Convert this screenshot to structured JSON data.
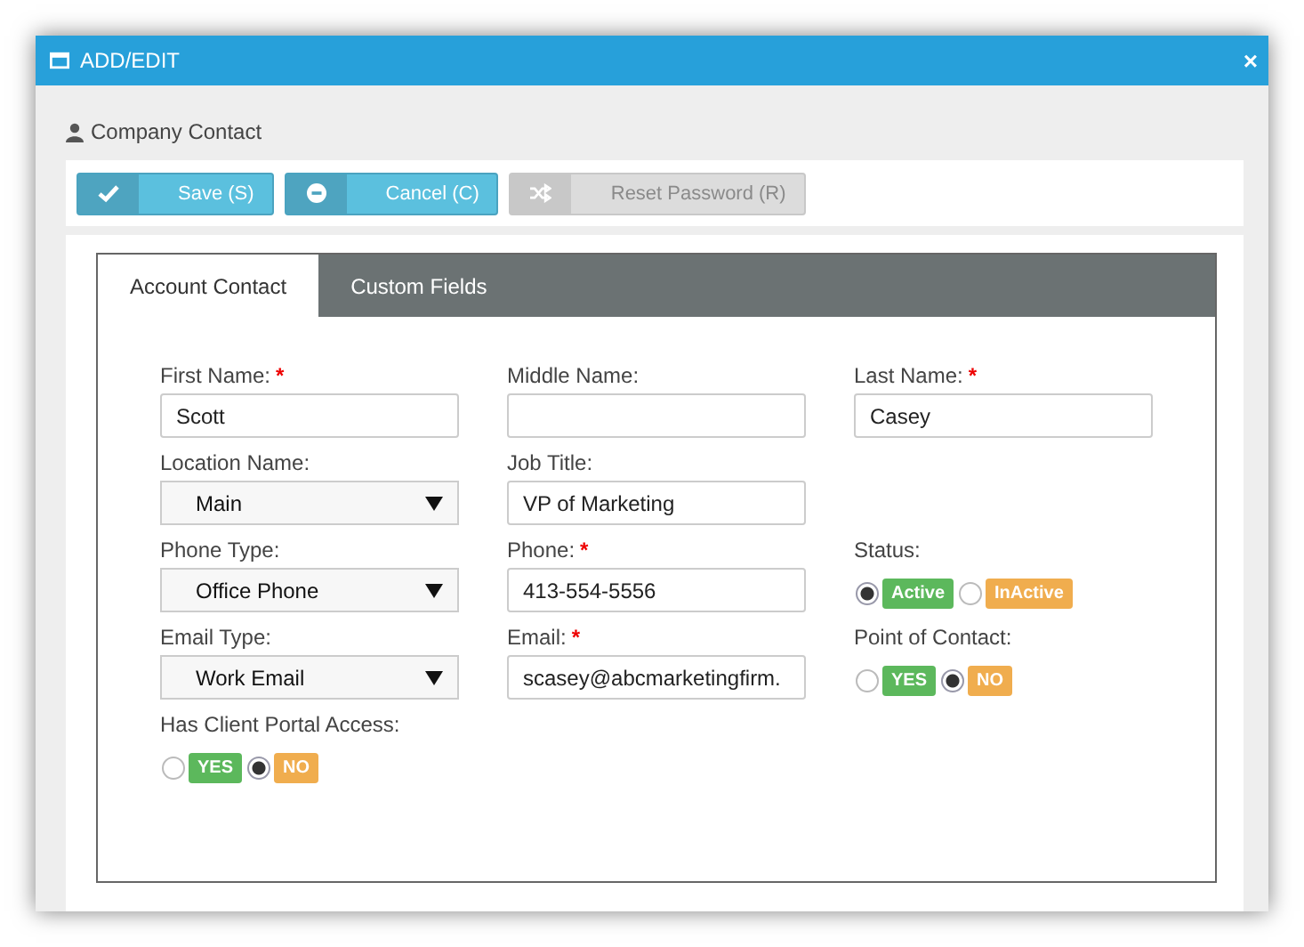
{
  "window": {
    "title": "ADD/EDIT",
    "close": "×"
  },
  "section_title": "Company Contact",
  "buttons": [
    {
      "kind": "save",
      "label": "Save (S)",
      "disabled": false
    },
    {
      "kind": "cancel",
      "label": "Cancel (C)",
      "disabled": false
    },
    {
      "kind": "reset",
      "label": "Reset Password (R)",
      "disabled": true
    }
  ],
  "tabs": [
    {
      "label": "Account Contact",
      "selected": true
    },
    {
      "label": "Custom Fields",
      "selected": false
    }
  ],
  "rows": [
    [
      {
        "kind": "text",
        "label": "First Name:",
        "required_mark": "*",
        "value": "Scott"
      },
      {
        "kind": "text",
        "label": "Middle Name:"
      },
      {
        "kind": "text",
        "label": "Last Name:",
        "required_mark": "*",
        "value": "Casey"
      }
    ],
    [
      {
        "kind": "select",
        "label": "Location Name:",
        "value": "Main"
      },
      {
        "kind": "text",
        "label": "Job Title:",
        "value": "VP of Marketing"
      }
    ],
    [
      {
        "kind": "select",
        "label": "Phone Type:",
        "value": "Office Phone"
      },
      {
        "kind": "text",
        "label": "Phone:",
        "required_mark": "*",
        "value": "413-554-5556"
      },
      {
        "kind": "radio",
        "label": "Status:",
        "options": [
          {
            "label": "Active",
            "selected": true,
            "color": "#5cb85c"
          },
          {
            "label": "InActive",
            "selected": false,
            "color": "#f0ad4e"
          }
        ]
      }
    ],
    [
      {
        "kind": "select",
        "label": "Email Type:",
        "value": "Work Email"
      },
      {
        "kind": "text",
        "label": "Email:",
        "required_mark": "*",
        "value": "scasey@abcmarketingfirm."
      },
      {
        "kind": "radio",
        "label": "Point of Contact:",
        "options": [
          {
            "label": "YES",
            "selected": false,
            "color": "#5cb85c"
          },
          {
            "label": "NO",
            "selected": true,
            "color": "#f0ad4e"
          }
        ]
      }
    ],
    [
      {
        "kind": "radio",
        "label": "Has Client Portal Access:",
        "options": [
          {
            "label": "YES",
            "selected": false,
            "color": "#5cb85c"
          },
          {
            "label": "NO",
            "selected": true,
            "color": "#f0ad4e"
          }
        ]
      }
    ]
  ]
}
